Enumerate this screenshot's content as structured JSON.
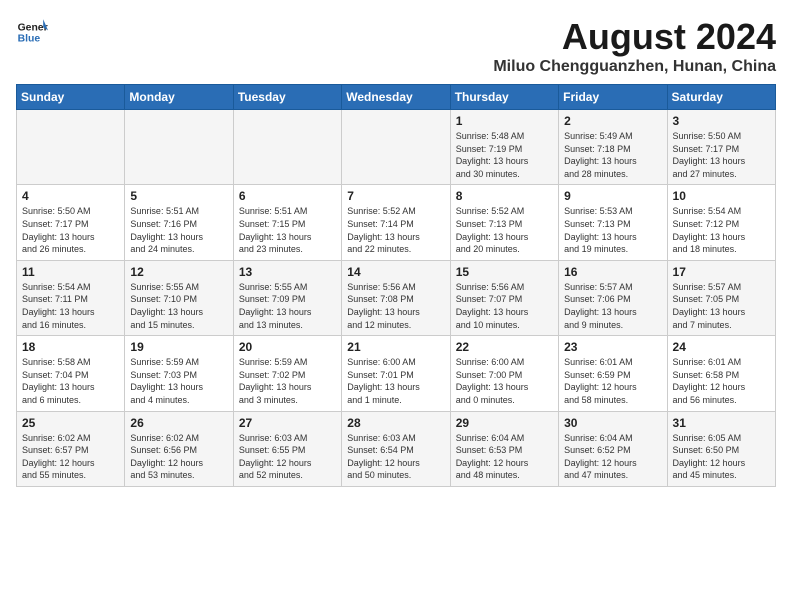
{
  "header": {
    "logo_line1": "General",
    "logo_line2": "Blue",
    "month": "August 2024",
    "location": "Miluo Chengguanzhen, Hunan, China"
  },
  "weekdays": [
    "Sunday",
    "Monday",
    "Tuesday",
    "Wednesday",
    "Thursday",
    "Friday",
    "Saturday"
  ],
  "weeks": [
    [
      {
        "day": "",
        "info": ""
      },
      {
        "day": "",
        "info": ""
      },
      {
        "day": "",
        "info": ""
      },
      {
        "day": "",
        "info": ""
      },
      {
        "day": "1",
        "info": "Sunrise: 5:48 AM\nSunset: 7:19 PM\nDaylight: 13 hours\nand 30 minutes."
      },
      {
        "day": "2",
        "info": "Sunrise: 5:49 AM\nSunset: 7:18 PM\nDaylight: 13 hours\nand 28 minutes."
      },
      {
        "day": "3",
        "info": "Sunrise: 5:50 AM\nSunset: 7:17 PM\nDaylight: 13 hours\nand 27 minutes."
      }
    ],
    [
      {
        "day": "4",
        "info": "Sunrise: 5:50 AM\nSunset: 7:17 PM\nDaylight: 13 hours\nand 26 minutes."
      },
      {
        "day": "5",
        "info": "Sunrise: 5:51 AM\nSunset: 7:16 PM\nDaylight: 13 hours\nand 24 minutes."
      },
      {
        "day": "6",
        "info": "Sunrise: 5:51 AM\nSunset: 7:15 PM\nDaylight: 13 hours\nand 23 minutes."
      },
      {
        "day": "7",
        "info": "Sunrise: 5:52 AM\nSunset: 7:14 PM\nDaylight: 13 hours\nand 22 minutes."
      },
      {
        "day": "8",
        "info": "Sunrise: 5:52 AM\nSunset: 7:13 PM\nDaylight: 13 hours\nand 20 minutes."
      },
      {
        "day": "9",
        "info": "Sunrise: 5:53 AM\nSunset: 7:13 PM\nDaylight: 13 hours\nand 19 minutes."
      },
      {
        "day": "10",
        "info": "Sunrise: 5:54 AM\nSunset: 7:12 PM\nDaylight: 13 hours\nand 18 minutes."
      }
    ],
    [
      {
        "day": "11",
        "info": "Sunrise: 5:54 AM\nSunset: 7:11 PM\nDaylight: 13 hours\nand 16 minutes."
      },
      {
        "day": "12",
        "info": "Sunrise: 5:55 AM\nSunset: 7:10 PM\nDaylight: 13 hours\nand 15 minutes."
      },
      {
        "day": "13",
        "info": "Sunrise: 5:55 AM\nSunset: 7:09 PM\nDaylight: 13 hours\nand 13 minutes."
      },
      {
        "day": "14",
        "info": "Sunrise: 5:56 AM\nSunset: 7:08 PM\nDaylight: 13 hours\nand 12 minutes."
      },
      {
        "day": "15",
        "info": "Sunrise: 5:56 AM\nSunset: 7:07 PM\nDaylight: 13 hours\nand 10 minutes."
      },
      {
        "day": "16",
        "info": "Sunrise: 5:57 AM\nSunset: 7:06 PM\nDaylight: 13 hours\nand 9 minutes."
      },
      {
        "day": "17",
        "info": "Sunrise: 5:57 AM\nSunset: 7:05 PM\nDaylight: 13 hours\nand 7 minutes."
      }
    ],
    [
      {
        "day": "18",
        "info": "Sunrise: 5:58 AM\nSunset: 7:04 PM\nDaylight: 13 hours\nand 6 minutes."
      },
      {
        "day": "19",
        "info": "Sunrise: 5:59 AM\nSunset: 7:03 PM\nDaylight: 13 hours\nand 4 minutes."
      },
      {
        "day": "20",
        "info": "Sunrise: 5:59 AM\nSunset: 7:02 PM\nDaylight: 13 hours\nand 3 minutes."
      },
      {
        "day": "21",
        "info": "Sunrise: 6:00 AM\nSunset: 7:01 PM\nDaylight: 13 hours\nand 1 minute."
      },
      {
        "day": "22",
        "info": "Sunrise: 6:00 AM\nSunset: 7:00 PM\nDaylight: 13 hours\nand 0 minutes."
      },
      {
        "day": "23",
        "info": "Sunrise: 6:01 AM\nSunset: 6:59 PM\nDaylight: 12 hours\nand 58 minutes."
      },
      {
        "day": "24",
        "info": "Sunrise: 6:01 AM\nSunset: 6:58 PM\nDaylight: 12 hours\nand 56 minutes."
      }
    ],
    [
      {
        "day": "25",
        "info": "Sunrise: 6:02 AM\nSunset: 6:57 PM\nDaylight: 12 hours\nand 55 minutes."
      },
      {
        "day": "26",
        "info": "Sunrise: 6:02 AM\nSunset: 6:56 PM\nDaylight: 12 hours\nand 53 minutes."
      },
      {
        "day": "27",
        "info": "Sunrise: 6:03 AM\nSunset: 6:55 PM\nDaylight: 12 hours\nand 52 minutes."
      },
      {
        "day": "28",
        "info": "Sunrise: 6:03 AM\nSunset: 6:54 PM\nDaylight: 12 hours\nand 50 minutes."
      },
      {
        "day": "29",
        "info": "Sunrise: 6:04 AM\nSunset: 6:53 PM\nDaylight: 12 hours\nand 48 minutes."
      },
      {
        "day": "30",
        "info": "Sunrise: 6:04 AM\nSunset: 6:52 PM\nDaylight: 12 hours\nand 47 minutes."
      },
      {
        "day": "31",
        "info": "Sunrise: 6:05 AM\nSunset: 6:50 PM\nDaylight: 12 hours\nand 45 minutes."
      }
    ]
  ]
}
